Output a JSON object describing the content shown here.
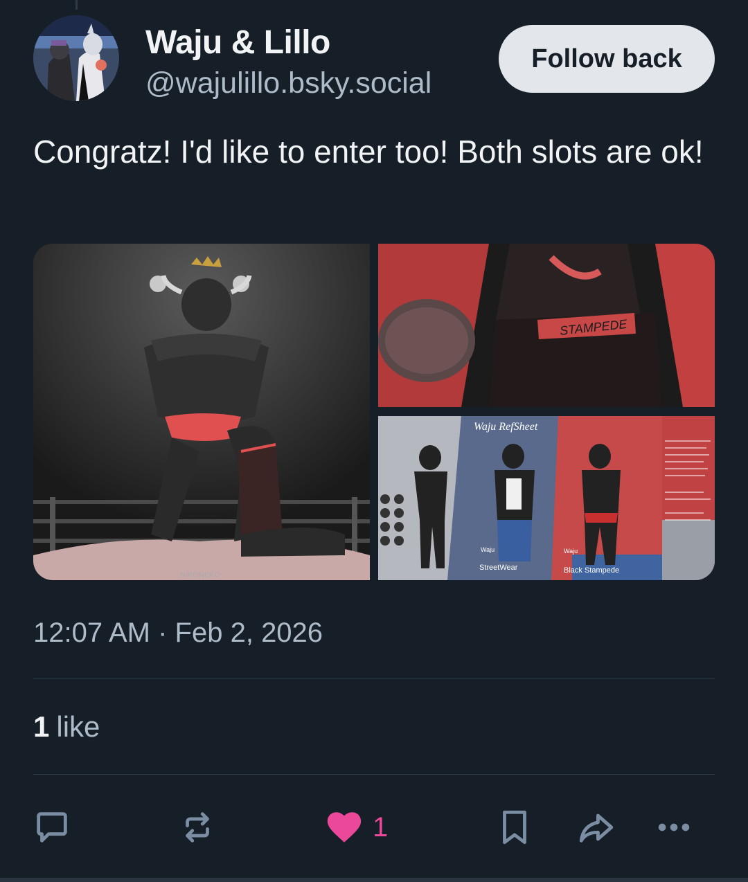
{
  "post": {
    "author_name": "Waju & Lillo",
    "author_handle": "@wajulillo.bsky.social",
    "follow_label": "Follow back",
    "text": "Congratz! I'd like to enter too! Both slots are ok!",
    "timestamp": "12:07 AM · Feb 2, 2026",
    "like_count": "1",
    "like_word": "like",
    "images": [
      {
        "kind": "wrestling-ring-artwork",
        "signature": "NIKONEKO"
      },
      {
        "kind": "closeup-artwork",
        "waistband_text": "STAMPEDE"
      },
      {
        "kind": "reference-sheet",
        "title": "Waju RefSheet",
        "label_left_1": "Waju",
        "label_left_2": "StreetWear",
        "label_right_1": "Waju",
        "label_right_2": "Black Stampede"
      }
    ]
  },
  "actions": {
    "reply_icon": "reply-icon",
    "repost_icon": "repost-icon",
    "like_icon": "heart-icon",
    "like_count": "1",
    "bookmark_icon": "bookmark-icon",
    "share_icon": "share-icon",
    "more_icon": "more-icon"
  },
  "colors": {
    "background": "#161e27",
    "secondary_text": "#aebbc9",
    "like_pink": "#ec4899",
    "follow_button": "#e3e7ec"
  }
}
